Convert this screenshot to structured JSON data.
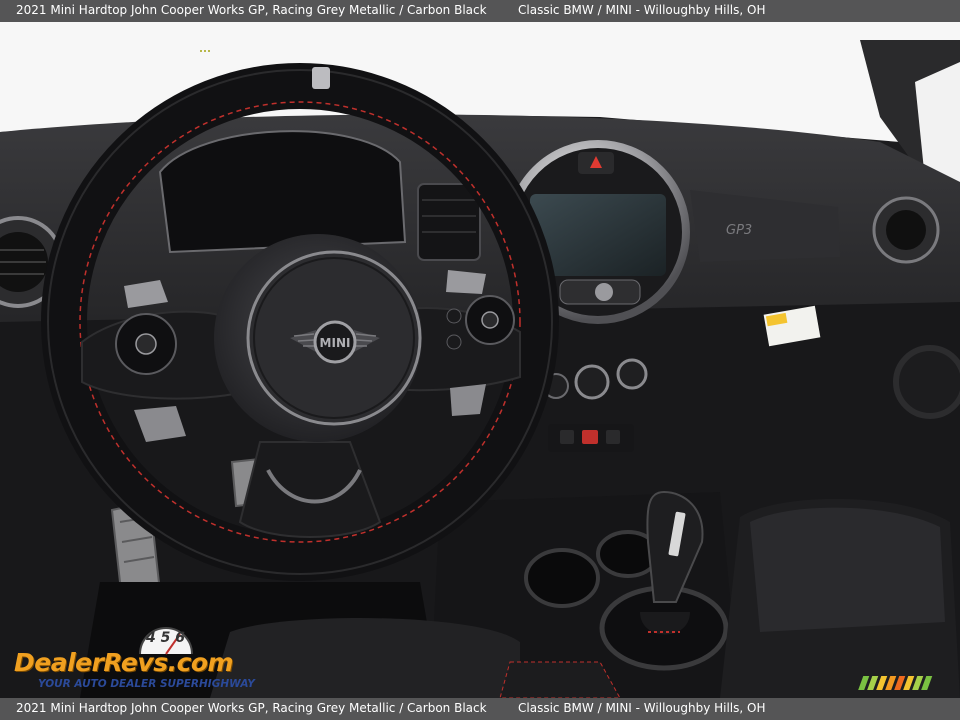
{
  "caption": {
    "top_left": "2021 Mini Hardtop John Cooper Works GP,  Racing Grey Metallic / Carbon Black",
    "top_right": "Classic BMW / MINI - Willoughby Hills, OH",
    "bottom_left": "2021 Mini Hardtop John Cooper Works GP,  Racing Grey Metallic / Carbon Black",
    "bottom_right": "Classic BMW / MINI - Willoughby Hills, OH"
  },
  "photo": {
    "subject": "car-interior-dashboard",
    "steering_badge": "MINI"
  },
  "watermark": {
    "brand": "DealerRevs.com",
    "tagline": "YOUR AUTO DEALER SUPERHIGHWAY",
    "dial": "4 5 6"
  },
  "colors": {
    "caption_bg": "#555556",
    "caption_text": "#ffffff",
    "brand_orange": "#f0a020",
    "tagline_blue": "#2b4a9a",
    "stitching_red": "#c0302c"
  },
  "icons": [
    "mini-wings-logo",
    "speedometer-dial-icon",
    "stripes-logo"
  ]
}
